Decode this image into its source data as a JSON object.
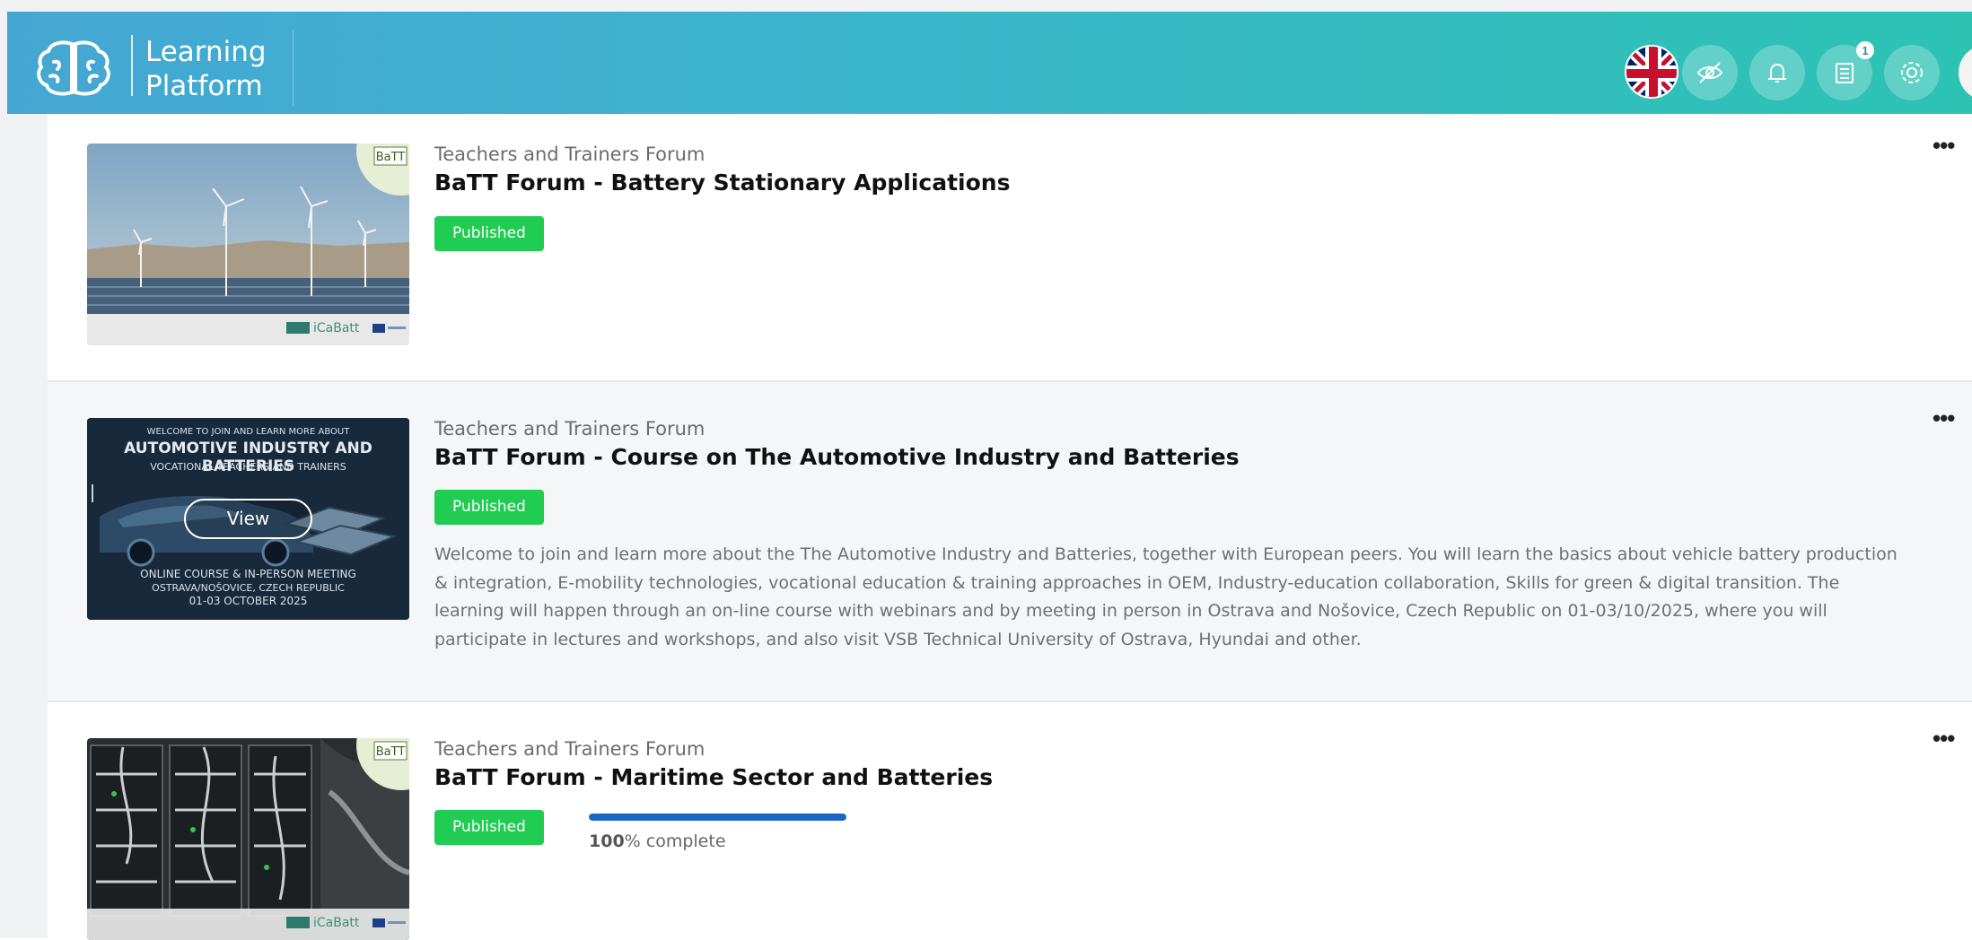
{
  "app": {
    "logo_line1": "Learning",
    "logo_line2": "Platform",
    "notification_count": "1"
  },
  "header": {
    "icons": [
      "uk-flag-icon",
      "eye-slash-icon",
      "bell-icon",
      "list-icon",
      "gear-icon",
      "avatar"
    ]
  },
  "courses": [
    {
      "category": "Teachers and Trainers Forum",
      "title": "BaTT Forum - Battery Stationary Applications",
      "status": "Published",
      "thumb_brand": "iCaBatt",
      "thumb_tag": "BaTT"
    },
    {
      "category": "Teachers and Trainers Forum",
      "title": "BaTT Forum - Course on The Automotive Industry and Batteries",
      "status": "Published",
      "view_label": "View",
      "thumb_line1": "WELCOME TO JOIN AND LEARN MORE ABOUT",
      "thumb_line2": "AUTOMOTIVE INDUSTRY AND BATTERIES",
      "thumb_line3": "VOCATIONAL TEACHERS AND TRAINERS",
      "thumb_line4": "ONLINE COURSE & IN-PERSON MEETING",
      "thumb_line5": "OSTRAVA/NOŠOVICE, CZECH REPUBLIC",
      "thumb_line6": "01-03 OCTOBER 2025",
      "description": "Welcome to join and learn more about the The Automotive Industry and Batteries, together with European peers. You will learn the basics about vehicle battery production & integration, E-mobility technologies, vocational education & training approaches in OEM, Industry-education collaboration, Skills for green & digital transition. The learning will happen through an on-line course with webinars and by meeting in person in Ostrava and Nošovice, Czech Republic on 01-03/10/2025, where you will participate in lectures and workshops, and also visit VSB Technical University of Ostrava, Hyundai and other."
    },
    {
      "category": "Teachers and Trainers Forum",
      "title": "BaTT Forum - Maritime Sector and Batteries",
      "status": "Published",
      "progress_value": 100,
      "progress_number": "100",
      "progress_suffix": "% complete",
      "thumb_brand": "iCaBatt",
      "thumb_tag": "BaTT"
    }
  ],
  "colors": {
    "published": "#21cc52",
    "progress": "#1a66c6",
    "header_start": "#44a7d3",
    "header_end": "#2cc3b3"
  }
}
